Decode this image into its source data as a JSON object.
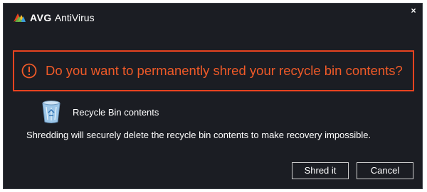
{
  "window": {
    "brand": "AVG",
    "product": "AntiVirus",
    "close_glyph": "×"
  },
  "warning": {
    "icon": "alert-circle-icon",
    "message": "Do you want to permanently shred your recycle bin contents?",
    "color": "#f05a28"
  },
  "item": {
    "icon": "recycle-bin-icon",
    "label": "Recycle Bin contents"
  },
  "description": "Shredding will securely delete the recycle bin contents to make recovery impossible.",
  "buttons": {
    "shred": "Shred it",
    "cancel": "Cancel"
  }
}
